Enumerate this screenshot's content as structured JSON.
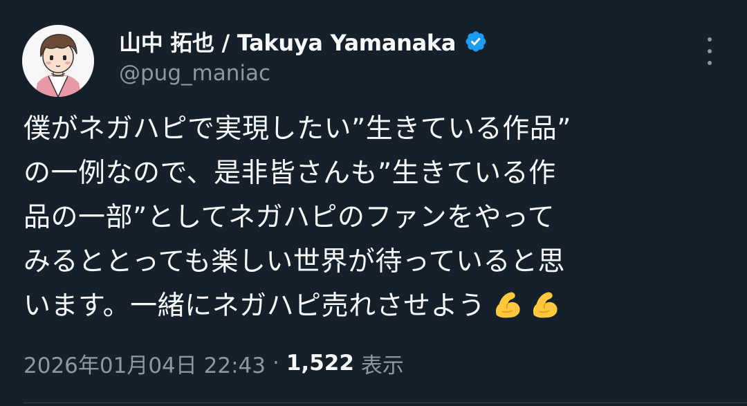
{
  "author": {
    "display_name": "山中 拓也 / Takuya Yamanaka",
    "handle": "@pug_maniac",
    "verified": true,
    "avatar_icon": "cartoon-avatar-icon"
  },
  "tweet": {
    "lines": [
      "僕がネガハピで実現したい”生きている作品”",
      "の一例なので、是非皆さんも”生きている作",
      "品の一部”としてネガハピのファンをやって",
      "みるととっても楽しい世界が待っていると思",
      "います。一緒にネガハピ売れさせよう"
    ],
    "emoji": [
      "flexed-biceps-icon",
      "flexed-biceps-icon"
    ]
  },
  "meta": {
    "timestamp": "2026年01月04日 22:43",
    "separator": "·",
    "views_count": "1,522",
    "views_label": "表示"
  },
  "colors": {
    "background": "#15202b",
    "text": "#f7f9f9",
    "muted": "#8b98a5",
    "verified": "#1d9bf0",
    "emoji": "#ffc83d"
  }
}
